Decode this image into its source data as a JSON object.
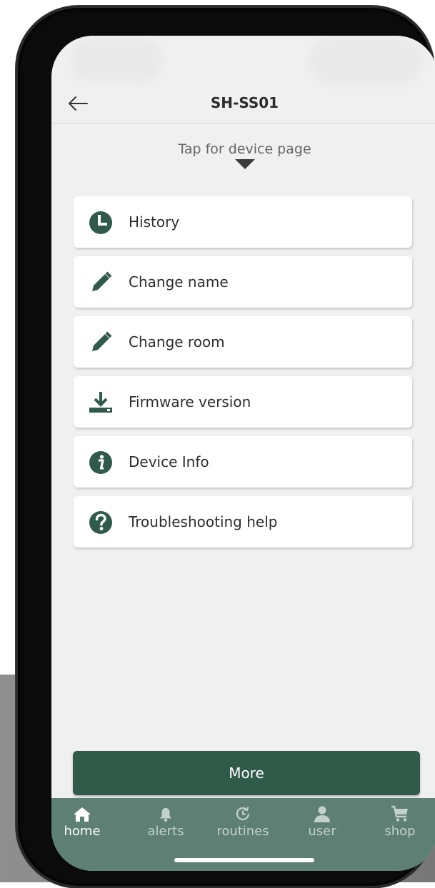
{
  "header": {
    "title": "SH-SS01",
    "back_icon": "arrow-left-icon"
  },
  "device_link": {
    "label": "Tap for device page",
    "icon": "caret-down-icon"
  },
  "menu": {
    "items": [
      {
        "label": "History",
        "icon": "clock-icon"
      },
      {
        "label": "Change name",
        "icon": "pencil-icon"
      },
      {
        "label": "Change room",
        "icon": "pencil-icon"
      },
      {
        "label": "Firmware version",
        "icon": "download-icon"
      },
      {
        "label": "Device Info",
        "icon": "info-icon"
      },
      {
        "label": "Troubleshooting help",
        "icon": "question-icon"
      }
    ]
  },
  "more_button": {
    "label": "More"
  },
  "tab_bar": {
    "tabs": [
      {
        "label": "home",
        "icon": "home-icon",
        "active": true
      },
      {
        "label": "alerts",
        "icon": "bell-icon",
        "active": false
      },
      {
        "label": "routines",
        "icon": "history-clock-icon",
        "active": false
      },
      {
        "label": "user",
        "icon": "user-icon",
        "active": false
      },
      {
        "label": "shop",
        "icon": "cart-icon",
        "active": false
      }
    ]
  },
  "colors": {
    "accent": "#305a4a",
    "tab_bar": "#5e7f73",
    "screen_bg": "#f0f0f0",
    "card_bg": "#ffffff"
  }
}
